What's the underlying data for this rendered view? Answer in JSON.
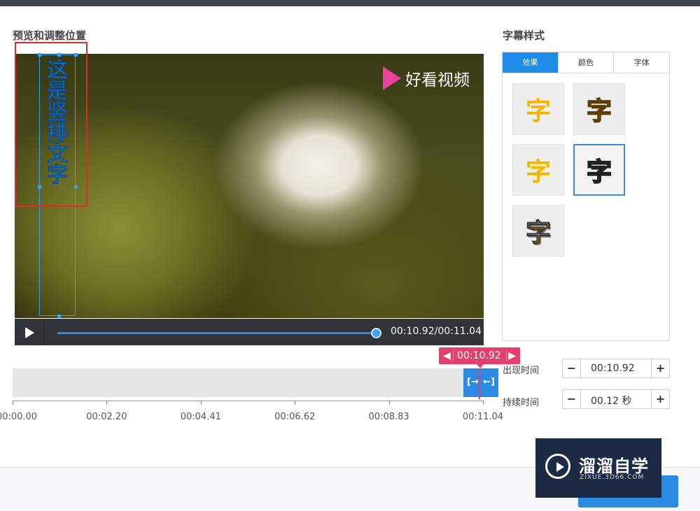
{
  "preview": {
    "title": "预览和调整位置"
  },
  "video": {
    "logo_text": "好看视频",
    "vertical_text": [
      "这",
      "是",
      "竖",
      "排",
      "文",
      "字"
    ],
    "time_readout": "00:10.92/00:11.04",
    "progress": 0.99
  },
  "style_panel": {
    "title": "字幕样式",
    "tabs": [
      {
        "label": "效果",
        "active": true
      },
      {
        "label": "颜色",
        "active": false
      },
      {
        "label": "字体",
        "active": false
      }
    ],
    "swatch_char": "字",
    "selected_index": 3
  },
  "timeline": {
    "current": "00:10.92",
    "ticks": [
      "00:00.00",
      "00:02.20",
      "00:04.41",
      "00:06.62",
      "00:08.83",
      "00:11.04"
    ],
    "clip_left": "[→",
    "clip_right": "←]"
  },
  "timing": {
    "appear_label": "出现时间",
    "appear_value": "00:10.92",
    "duration_label": "持续时间",
    "duration_value": "00.12 秒",
    "minus": "−",
    "plus": "+"
  },
  "watermark": {
    "title": "溜溜自学",
    "subtitle": "ZIXUE.3D66.COM"
  },
  "colors": {
    "accent": "#2b8ae2",
    "pink": "#e43f6e",
    "yellow": "#f5b400",
    "text_blue": "#1f8de8"
  }
}
